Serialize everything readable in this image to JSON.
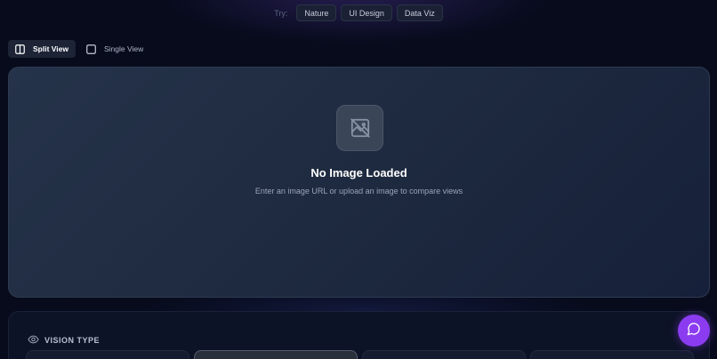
{
  "samples": {
    "label": "Try:",
    "items": [
      "Nature",
      "UI Design",
      "Data Viz"
    ]
  },
  "view_modes": {
    "split": "Split View",
    "single": "Single View",
    "active": "split"
  },
  "viewer": {
    "empty_icon": "image-off-icon",
    "title": "No Image Loaded",
    "subtitle": "Enter an image URL or upload an image to compare views"
  },
  "vision_panel": {
    "icon": "eye-icon",
    "title": "VISION TYPE",
    "selected_index": 1
  },
  "chat": {
    "icon": "chat-bubble-icon",
    "color": "#8b3cf0"
  },
  "colors": {
    "background": "#070b1c",
    "viewer_bg": "#1e2a3f",
    "accent": "#8b3cf0"
  }
}
